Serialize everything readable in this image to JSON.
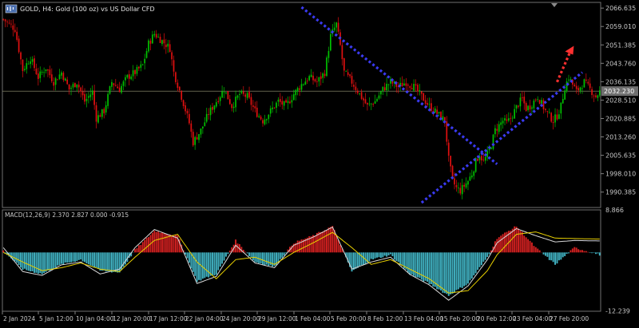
{
  "window": {
    "symbol_title": "GOLD, H4:  Gold (100 oz) vs US Dollar CFD",
    "current_price_label": "2032.230"
  },
  "colors": {
    "background": "#000000",
    "bull": "#00c000",
    "bear": "#e01010",
    "axis_text": "#c8c8c8",
    "trendline": "#3a3af0",
    "arrow": "#ff3030",
    "macd_positive": "#d02020",
    "macd_negative": "#40b0c0",
    "macd_line": "#d8d8d8",
    "signal_line": "#e8d000"
  },
  "chart_data": [
    {
      "type": "candlestick",
      "title": "GOLD, H4:  Gold (100 oz) vs US Dollar CFD",
      "ylim": [
        1984.0,
        2069.0
      ],
      "y_ticks": [
        "2066.635",
        "2059.010",
        "2051.385",
        "2043.760",
        "2036.135",
        "2028.510",
        "2020.885",
        "2013.260",
        "2005.635",
        "1998.010",
        "1990.385"
      ],
      "x_ticks": [
        "2 Jan 2024",
        "5 Jan 12:00",
        "10 Jan 04:00",
        "12 Jan 20:00",
        "17 Jan 12:00",
        "22 Jan 04:00",
        "24 Jan 20:00",
        "29 Jan 12:00",
        "1 Feb 04:00",
        "5 Feb 20:00",
        "8 Feb 12:00",
        "13 Feb 04:00",
        "15 Feb 20:00",
        "20 Feb 12:00",
        "23 Feb 04:00",
        "27 Feb 20:00"
      ],
      "current_price": 2032.23,
      "close_path": [
        [
          0,
          2062
        ],
        [
          6,
          2058
        ],
        [
          10,
          2041
        ],
        [
          14,
          2046
        ],
        [
          18,
          2038
        ],
        [
          22,
          2042
        ],
        [
          26,
          2036
        ],
        [
          30,
          2040
        ],
        [
          34,
          2033
        ],
        [
          38,
          2036
        ],
        [
          42,
          2028
        ],
        [
          46,
          2032
        ],
        [
          48,
          2021
        ],
        [
          52,
          2024
        ],
        [
          56,
          2036
        ],
        [
          60,
          2033
        ],
        [
          64,
          2038
        ],
        [
          68,
          2040
        ],
        [
          72,
          2043
        ],
        [
          75,
          2052
        ],
        [
          78,
          2056
        ],
        [
          82,
          2053
        ],
        [
          86,
          2050
        ],
        [
          88,
          2040
        ],
        [
          92,
          2030
        ],
        [
          96,
          2019
        ],
        [
          98,
          2011
        ],
        [
          102,
          2016
        ],
        [
          106,
          2023
        ],
        [
          110,
          2028
        ],
        [
          114,
          2033
        ],
        [
          118,
          2026
        ],
        [
          122,
          2031
        ],
        [
          126,
          2030
        ],
        [
          130,
          2024
        ],
        [
          134,
          2020
        ],
        [
          138,
          2024
        ],
        [
          142,
          2028
        ],
        [
          146,
          2026
        ],
        [
          150,
          2031
        ],
        [
          154,
          2035
        ],
        [
          158,
          2038
        ],
        [
          162,
          2036
        ],
        [
          166,
          2040
        ],
        [
          169,
          2055
        ],
        [
          172,
          2060
        ],
        [
          174,
          2051
        ],
        [
          176,
          2040
        ],
        [
          180,
          2036
        ],
        [
          184,
          2031
        ],
        [
          188,
          2026
        ],
        [
          192,
          2028
        ],
        [
          196,
          2033
        ],
        [
          200,
          2036
        ],
        [
          204,
          2034
        ],
        [
          208,
          2036
        ],
        [
          212,
          2034
        ],
        [
          216,
          2030
        ],
        [
          220,
          2026
        ],
        [
          224,
          2023
        ],
        [
          228,
          2020
        ],
        [
          230,
          2004
        ],
        [
          232,
          1995
        ],
        [
          234,
          1992
        ],
        [
          236,
          1991
        ],
        [
          238,
          1993
        ],
        [
          240,
          1995
        ],
        [
          242,
          1998
        ],
        [
          244,
          2003
        ],
        [
          246,
          2006
        ],
        [
          248,
          2003
        ],
        [
          250,
          2006
        ],
        [
          252,
          2010
        ],
        [
          254,
          2016
        ],
        [
          256,
          2018
        ],
        [
          258,
          2020
        ],
        [
          260,
          2019
        ],
        [
          262,
          2021
        ],
        [
          264,
          2024
        ],
        [
          266,
          2027
        ],
        [
          268,
          2029
        ],
        [
          270,
          2025
        ],
        [
          272,
          2026
        ],
        [
          274,
          2028
        ],
        [
          276,
          2030
        ],
        [
          278,
          2027
        ],
        [
          280,
          2024
        ],
        [
          282,
          2022
        ],
        [
          284,
          2020
        ],
        [
          286,
          2022
        ],
        [
          288,
          2026
        ],
        [
          290,
          2034
        ],
        [
          292,
          2038
        ],
        [
          294,
          2035
        ],
        [
          296,
          2032
        ],
        [
          298,
          2034
        ],
        [
          300,
          2036
        ],
        [
          302,
          2034
        ],
        [
          304,
          2032
        ],
        [
          306,
          2030
        ],
        [
          308,
          2032
        ]
      ]
    },
    {
      "type": "macd",
      "label": "MACD(12,26,9) 2.370 2.827 0.000 -0.915",
      "ylim": [
        -12.3,
        8.9
      ],
      "y_ticks": [
        "8.866",
        "-12.239"
      ],
      "histogram": [
        [
          0,
          0.3
        ],
        [
          10,
          -3.5
        ],
        [
          20,
          -4.5
        ],
        [
          30,
          -2.5
        ],
        [
          40,
          -1.5
        ],
        [
          50,
          -3.8
        ],
        [
          60,
          -4.2
        ],
        [
          68,
          0.5
        ],
        [
          78,
          4.5
        ],
        [
          90,
          3.5
        ],
        [
          100,
          -6.0
        ],
        [
          110,
          -4.5
        ],
        [
          120,
          2.5
        ],
        [
          130,
          -2.0
        ],
        [
          140,
          -3.0
        ],
        [
          150,
          2.0
        ],
        [
          160,
          3.5
        ],
        [
          170,
          5.5
        ],
        [
          180,
          -4.0
        ],
        [
          190,
          -1.5
        ],
        [
          200,
          -0.5
        ],
        [
          210,
          -4.5
        ],
        [
          220,
          -6.5
        ],
        [
          230,
          -9.0
        ],
        [
          240,
          -6.5
        ],
        [
          250,
          -1.0
        ],
        [
          255,
          3.0
        ],
        [
          265,
          5.5
        ],
        [
          275,
          1.0
        ],
        [
          285,
          -2.5
        ],
        [
          295,
          1.0
        ],
        [
          308,
          -0.5
        ]
      ],
      "macd_line": [
        [
          0,
          1.0
        ],
        [
          10,
          -4.0
        ],
        [
          20,
          -4.8
        ],
        [
          30,
          -2.6
        ],
        [
          40,
          -2.0
        ],
        [
          50,
          -4.5
        ],
        [
          60,
          -3.5
        ],
        [
          68,
          1.0
        ],
        [
          78,
          4.8
        ],
        [
          90,
          3.0
        ],
        [
          100,
          -6.5
        ],
        [
          110,
          -5.0
        ],
        [
          120,
          1.5
        ],
        [
          130,
          -2.2
        ],
        [
          140,
          -3.2
        ],
        [
          150,
          1.5
        ],
        [
          160,
          3.2
        ],
        [
          170,
          5.3
        ],
        [
          180,
          -3.5
        ],
        [
          190,
          -2.0
        ],
        [
          200,
          -1.0
        ],
        [
          210,
          -4.6
        ],
        [
          220,
          -6.8
        ],
        [
          230,
          -10.0
        ],
        [
          240,
          -7.0
        ],
        [
          250,
          -1.5
        ],
        [
          255,
          2.0
        ],
        [
          265,
          5.0
        ],
        [
          275,
          3.5
        ],
        [
          285,
          2.2
        ],
        [
          295,
          2.5
        ],
        [
          308,
          2.4
        ]
      ],
      "signal_line": [
        [
          0,
          0.0
        ],
        [
          10,
          -2.0
        ],
        [
          20,
          -3.8
        ],
        [
          30,
          -3.2
        ],
        [
          40,
          -2.2
        ],
        [
          50,
          -3.5
        ],
        [
          60,
          -4.0
        ],
        [
          68,
          -1.0
        ],
        [
          78,
          2.5
        ],
        [
          90,
          3.8
        ],
        [
          100,
          -2.0
        ],
        [
          110,
          -5.5
        ],
        [
          120,
          -1.5
        ],
        [
          130,
          -1.0
        ],
        [
          140,
          -2.5
        ],
        [
          150,
          0.0
        ],
        [
          160,
          2.0
        ],
        [
          170,
          4.2
        ],
        [
          180,
          1.0
        ],
        [
          190,
          -2.5
        ],
        [
          200,
          -1.5
        ],
        [
          210,
          -3.5
        ],
        [
          220,
          -5.5
        ],
        [
          230,
          -8.5
        ],
        [
          240,
          -8.0
        ],
        [
          250,
          -3.8
        ],
        [
          255,
          -0.5
        ],
        [
          265,
          3.8
        ],
        [
          275,
          4.3
        ],
        [
          285,
          3.0
        ],
        [
          295,
          2.9
        ],
        [
          308,
          2.8
        ]
      ]
    }
  ]
}
